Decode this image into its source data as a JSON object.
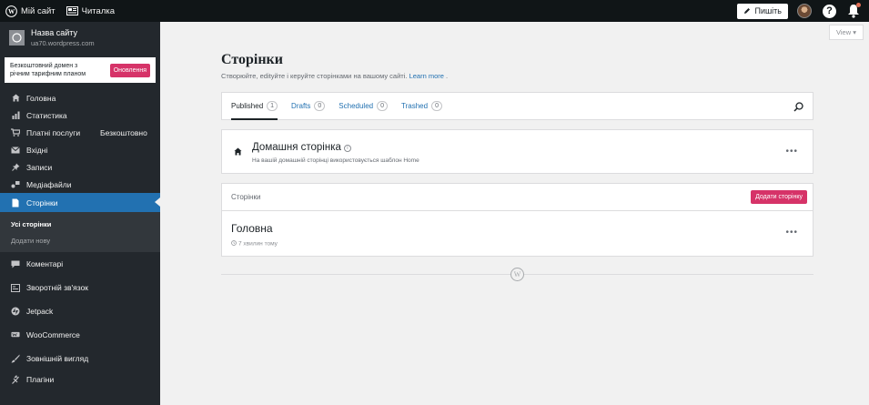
{
  "topbar": {
    "my_site": "Мій сайт",
    "reader": "Читалка",
    "write": "Пишіть"
  },
  "sidebar": {
    "site_name": "Назва сайту",
    "site_url": "ua70.wordpress.com",
    "promo_text": "Безкоштовний домен з річним тарифним планом",
    "promo_button": "Оновлення",
    "items": [
      {
        "label": "Головна",
        "icon": "home-icon"
      },
      {
        "label": "Статистика",
        "icon": "stats-icon"
      },
      {
        "label": "Платні послуги",
        "icon": "cart-icon",
        "extra": "Безкоштовно"
      },
      {
        "label": "Вхідні",
        "icon": "inbox-icon"
      },
      {
        "label": "Записи",
        "icon": "pin-icon"
      },
      {
        "label": "Медіафайли",
        "icon": "media-icon"
      },
      {
        "label": "Сторінки",
        "icon": "pages-icon"
      },
      {
        "label": "Коментарі",
        "icon": "comments-icon"
      },
      {
        "label": "Зворотній зв'язок",
        "icon": "feedback-icon"
      },
      {
        "label": "Jetpack",
        "icon": "jetpack-icon"
      },
      {
        "label": "WooCommerce",
        "icon": "woocommerce-icon"
      },
      {
        "label": "Зовнішній вигляд",
        "icon": "appearance-icon"
      },
      {
        "label": "Плагіни",
        "icon": "plugins-icon"
      }
    ],
    "submenu": [
      "Усі сторінки",
      "Додати нову"
    ]
  },
  "main": {
    "view_button": "View ▾",
    "title": "Сторінки",
    "subtitle": "Створюйте, edityйте і керуйте сторінками на вашому сайті.",
    "learn_more": "Learn more",
    "tabs": [
      {
        "label": "Published",
        "count": "1"
      },
      {
        "label": "Drafts",
        "count": "0"
      },
      {
        "label": "Scheduled",
        "count": "0"
      },
      {
        "label": "Trashed",
        "count": "0"
      }
    ],
    "home_card": {
      "title": "Домашня сторінка",
      "info": "i",
      "description": "На вашій домашній сторінці використовується шаблон Home",
      "menu": "•••"
    },
    "list_header": "Сторінки",
    "add_page": "Додати сторінку",
    "rows": [
      {
        "title": "Головна",
        "meta": "7 хвилин тому",
        "menu": "•••"
      }
    ],
    "footer_logo": "W"
  },
  "colors": {
    "accent": "#2271b1",
    "pink": "#d63368",
    "sidebar": "#23282d",
    "topbar": "#101517"
  }
}
